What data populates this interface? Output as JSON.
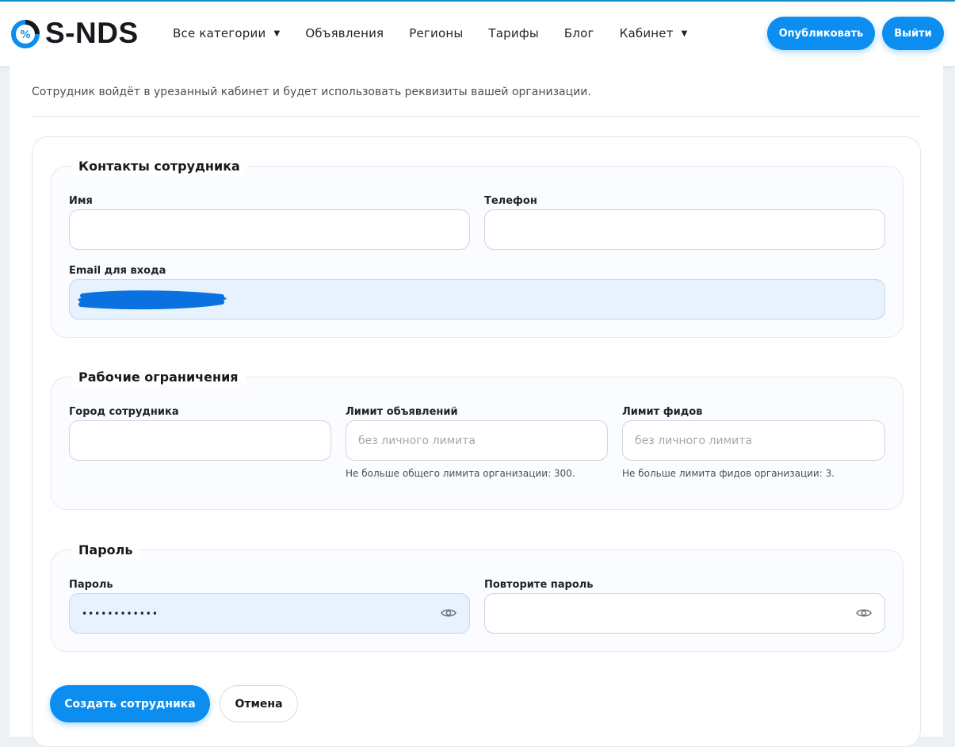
{
  "brand": {
    "name": "S-NDS",
    "mark_symbol": "%"
  },
  "nav": {
    "items": [
      {
        "label": "Все категории",
        "has_dropdown": true
      },
      {
        "label": "Объявления",
        "has_dropdown": false
      },
      {
        "label": "Регионы",
        "has_dropdown": false
      },
      {
        "label": "Тарифы",
        "has_dropdown": false
      },
      {
        "label": "Блог",
        "has_dropdown": false
      },
      {
        "label": "Кабинет",
        "has_dropdown": true
      }
    ],
    "dropdown_caret": "▼",
    "publish_label": "Опубликовать",
    "logout_label": "Выйти"
  },
  "intro_text": "Сотрудник войдёт в урезанный кабинет и будет использовать реквизиты вашей организации.",
  "contacts": {
    "legend": "Контакты сотрудника",
    "name_label": "Имя",
    "name_value": "",
    "phone_label": "Телефон",
    "phone_value": "",
    "email_label": "Email для входа",
    "email_value": ""
  },
  "limits": {
    "legend": "Рабочие ограничения",
    "city_label": "Город сотрудника",
    "city_value": "",
    "ads_limit_label": "Лимит объявлений",
    "ads_limit_placeholder": "без личного лимита",
    "ads_limit_hint": "Не больше общего лимита организации: 300.",
    "feeds_limit_label": "Лимит фидов",
    "feeds_limit_placeholder": "без личного лимита",
    "feeds_limit_hint": "Не больше лимита фидов организации: 3."
  },
  "password": {
    "legend": "Пароль",
    "password_label": "Пароль",
    "password_value": "••••••••••••",
    "repeat_label": "Повторите пароль",
    "repeat_value": ""
  },
  "actions": {
    "create_label": "Создать сотрудника",
    "cancel_label": "Отмена"
  },
  "colors": {
    "accent": "#0c8ef0",
    "filled_input_bg": "#e8f2fe",
    "redaction": "#0a72e0"
  }
}
